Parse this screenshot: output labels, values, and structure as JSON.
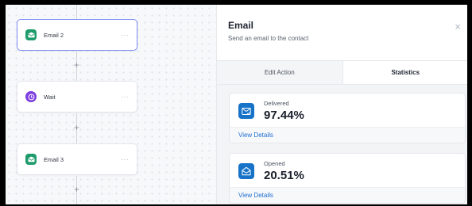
{
  "workflow": {
    "nodes": [
      {
        "label": "Email 2",
        "menu": "···",
        "icon": "email-icon",
        "color": "#1e9b6b",
        "selected": true
      },
      {
        "label": "Wait",
        "menu": "···",
        "icon": "clock-icon",
        "color": "#7e3fe0",
        "selected": false
      },
      {
        "label": "Email 3",
        "menu": "···",
        "icon": "email-icon",
        "color": "#1e9b6b",
        "selected": false
      }
    ],
    "add_symbol": "+"
  },
  "panel": {
    "title": "Email",
    "subtitle": "Send an email to the contact",
    "close_symbol": "×",
    "tabs": [
      {
        "label": "Edit Action",
        "active": false
      },
      {
        "label": "Statistics",
        "active": true
      }
    ],
    "stats": [
      {
        "label": "Delivered",
        "value": "97.44%",
        "link": "View Details",
        "icon": "delivered-envelope-icon"
      },
      {
        "label": "Opened",
        "value": "20.51%",
        "link": "View Details",
        "icon": "opened-envelope-icon"
      }
    ]
  },
  "colors": {
    "accent_blue": "#1773c8",
    "link_blue": "#1e6fd0",
    "selected_border": "#7c8cf5"
  }
}
